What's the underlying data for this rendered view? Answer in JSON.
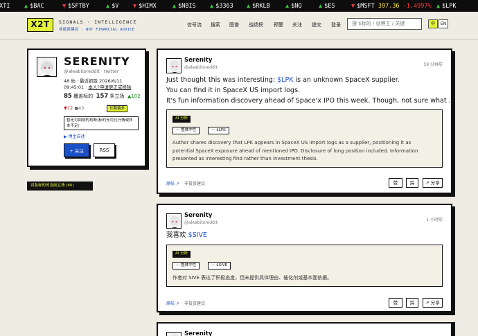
{
  "ticker": [
    {
      "symbol": "AXTI",
      "mark": "",
      "price": "",
      "change": ""
    },
    {
      "symbol": "$BAC",
      "mark": "▲",
      "price": "",
      "change": ""
    },
    {
      "symbol": "$SFTBY",
      "mark": "▼",
      "price": "",
      "change": ""
    },
    {
      "symbol": "$V",
      "mark": "▲",
      "price": "",
      "change": ""
    },
    {
      "symbol": "$HIMX",
      "mark": "▼",
      "price": "",
      "change": ""
    },
    {
      "symbol": "$NBIS",
      "mark": "▲",
      "price": "",
      "change": ""
    },
    {
      "symbol": "$3363",
      "mark": "▲",
      "price": "",
      "change": ""
    },
    {
      "symbol": "$RKLB",
      "mark": "▲",
      "price": "",
      "change": ""
    },
    {
      "symbol": "$NQ",
      "mark": "▲",
      "price": "",
      "change": ""
    },
    {
      "symbol": "$ES",
      "mark": "▲",
      "price": "",
      "change": ""
    },
    {
      "symbol": "$MSFT",
      "mark": "▼",
      "price": "397.36",
      "change": "-1.4997%"
    },
    {
      "symbol": "$LPK",
      "mark": "▲",
      "price": "",
      "change": ""
    }
  ],
  "header": {
    "logo": "X2T",
    "tagline": "SIGNALS · INTELLIGENCE",
    "disclaimer": "非投资建议 · NOT FINANCIAL ADVICE",
    "nav": [
      "信号流",
      "搜索",
      "图谱",
      "战绩榜",
      "预警",
      "关注",
      "提交",
      "登录"
    ],
    "search_placeholder": "搜 $标的 / @博主 / 关键",
    "lang_zh": "中",
    "lang_en": "EN"
  },
  "profile": {
    "name": "SERENITY",
    "handle": "@aleabitoreddit · twitter",
    "meta1": "48 帖 · 最近抓取 2026/6/11",
    "meta2_time": "09:45:01 · ",
    "meta2_link": "本人?申请更正或移除",
    "stats_tickers": "85",
    "stats_tickers_label": "覆盖标的",
    "stats_positions": "157",
    "stats_positions_label": "条立场",
    "stats_up": "▲102",
    "votes_down": "▼12",
    "votes_neutral": "●43",
    "tag": "长期偏多",
    "note": "暂无可回测的判断(标的无可比行情或样本不足)",
    "challenge": "▶ 博主自述",
    "follow_label": "+ 关注",
    "rss_label": "RSS"
  },
  "positions_bar": "对各标的的当前立场 (80)",
  "posts": [
    {
      "name": "Serenity",
      "handle": "@aleabitoreddit",
      "time": "59 分钟前",
      "line1_pre": "Just thought this was interesting: ",
      "line1_cash": "$LPK",
      "line1_post": " is an unknown SpaceX supplier.",
      "line2": "You can find it in SpaceX US import logs.",
      "line3": "It's fun information discovery ahead of Space'x IPO this week. Though, not sure what ...",
      "ai_tag": "AI 分析",
      "chip_overall": "— 整体中性",
      "chip_ticker": "— $LPK",
      "ai_text1": "Author shares discovery that LPK appears in SpaceX US import logs as a supplier, positioning it as",
      "ai_text2": "potential SpaceX exposure ahead of mentioned IPO. Disclosure of long position included. Information",
      "ai_text3": "presented as interesting find rather than investment thesis.",
      "origin": "原帖 ↗",
      "not_advice": "非投资建议",
      "btn_like": "赞",
      "btn_doubt": "踩",
      "btn_share": "↗ 分享"
    },
    {
      "name": "Serenity",
      "handle": "@aleabitoreddit",
      "time": "1 小时前",
      "line1_pre": "我喜欢 ",
      "line1_cash": "$SIVE",
      "ai_tag": "AI 分析",
      "chip_overall": "— 整体中性",
      "chip_ticker": "— $SIVE",
      "ai_text1": "作者对 SIVE 表达了积极态度，但未提供具体理由、催化剂或基本面依据。",
      "origin": "原帖 ↗",
      "not_advice": "非投资建议",
      "btn_like": "赞",
      "btn_doubt": "踩",
      "btn_share": "↗ 分享"
    },
    {
      "name": "Serenity"
    }
  ],
  "colors": {
    "accent": "#e2f33a",
    "link": "#1b4fc4",
    "up": "#3ec63e",
    "down": "#ff3b3b",
    "background": "#efece4"
  }
}
